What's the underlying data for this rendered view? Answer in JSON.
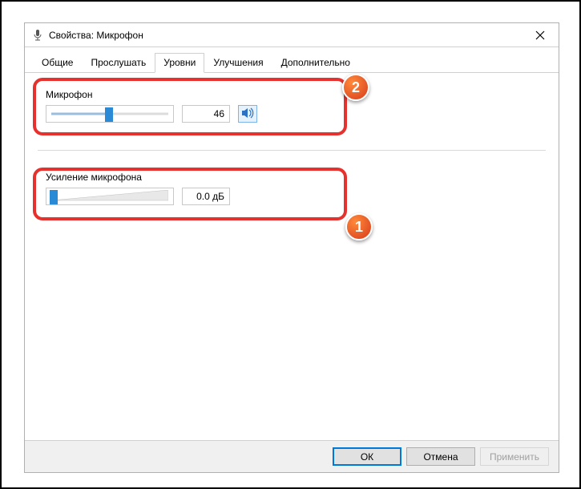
{
  "titlebar": {
    "title": "Свойства: Микрофон"
  },
  "tabs": {
    "t0": "Общие",
    "t1": "Прослушать",
    "t2": "Уровни",
    "t3": "Улучшения",
    "t4": "Дополнительно"
  },
  "mic": {
    "label": "Микрофон",
    "value": "46",
    "slider_percent": 46
  },
  "boost": {
    "label": "Усиление микрофона",
    "value": "0.0 дБ",
    "slider_percent": 0
  },
  "buttons": {
    "ok": "ОК",
    "cancel": "Отмена",
    "apply": "Применить"
  },
  "callouts": {
    "c1": "1",
    "c2": "2"
  },
  "colors": {
    "accent": "#0078d7",
    "highlight": "#e5322e"
  }
}
